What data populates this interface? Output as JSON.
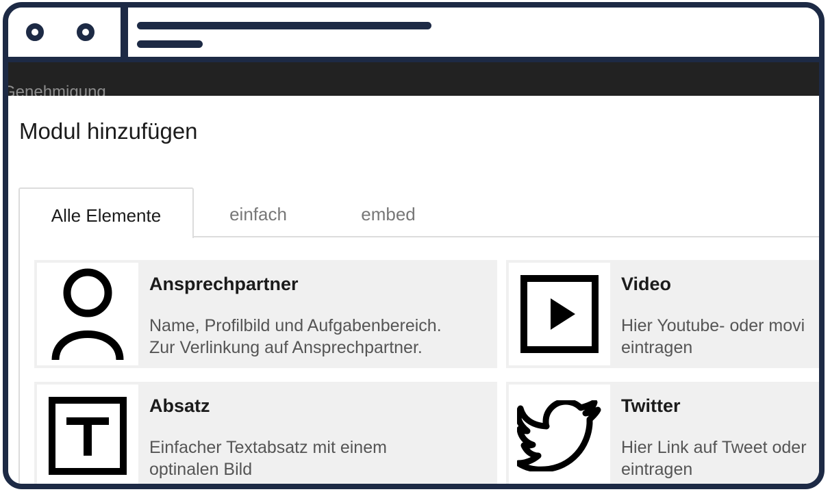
{
  "background_bar": {
    "text": "Genehmigung"
  },
  "modal": {
    "title": "Modul hinzufügen",
    "tabs": [
      {
        "label": "Alle Elemente",
        "active": true
      },
      {
        "label": "einfach",
        "active": false
      },
      {
        "label": "embed",
        "active": false
      }
    ],
    "modules": [
      {
        "title": "Ansprechpartner",
        "description": "Name, Profilbild und Aufgabenbereich.\nZur Verlinkung auf Ansprechpartner.",
        "icon": "person-icon"
      },
      {
        "title": "Video",
        "description": "Hier Youtube- oder movi\neintragen",
        "icon": "video-play-icon"
      },
      {
        "title": "Absatz",
        "description": "Einfacher Textabsatz mit einem\noptinalen Bild",
        "icon": "text-paragraph-icon"
      },
      {
        "title": "Twitter",
        "description": "Hier Link auf Tweet oder\neintragen",
        "icon": "twitter-bird-icon"
      }
    ]
  },
  "colors": {
    "frame": "#1d2a45",
    "dark_bar": "#222222",
    "card_background": "#f0f0f0",
    "tab_border": "#dcdcdc"
  }
}
